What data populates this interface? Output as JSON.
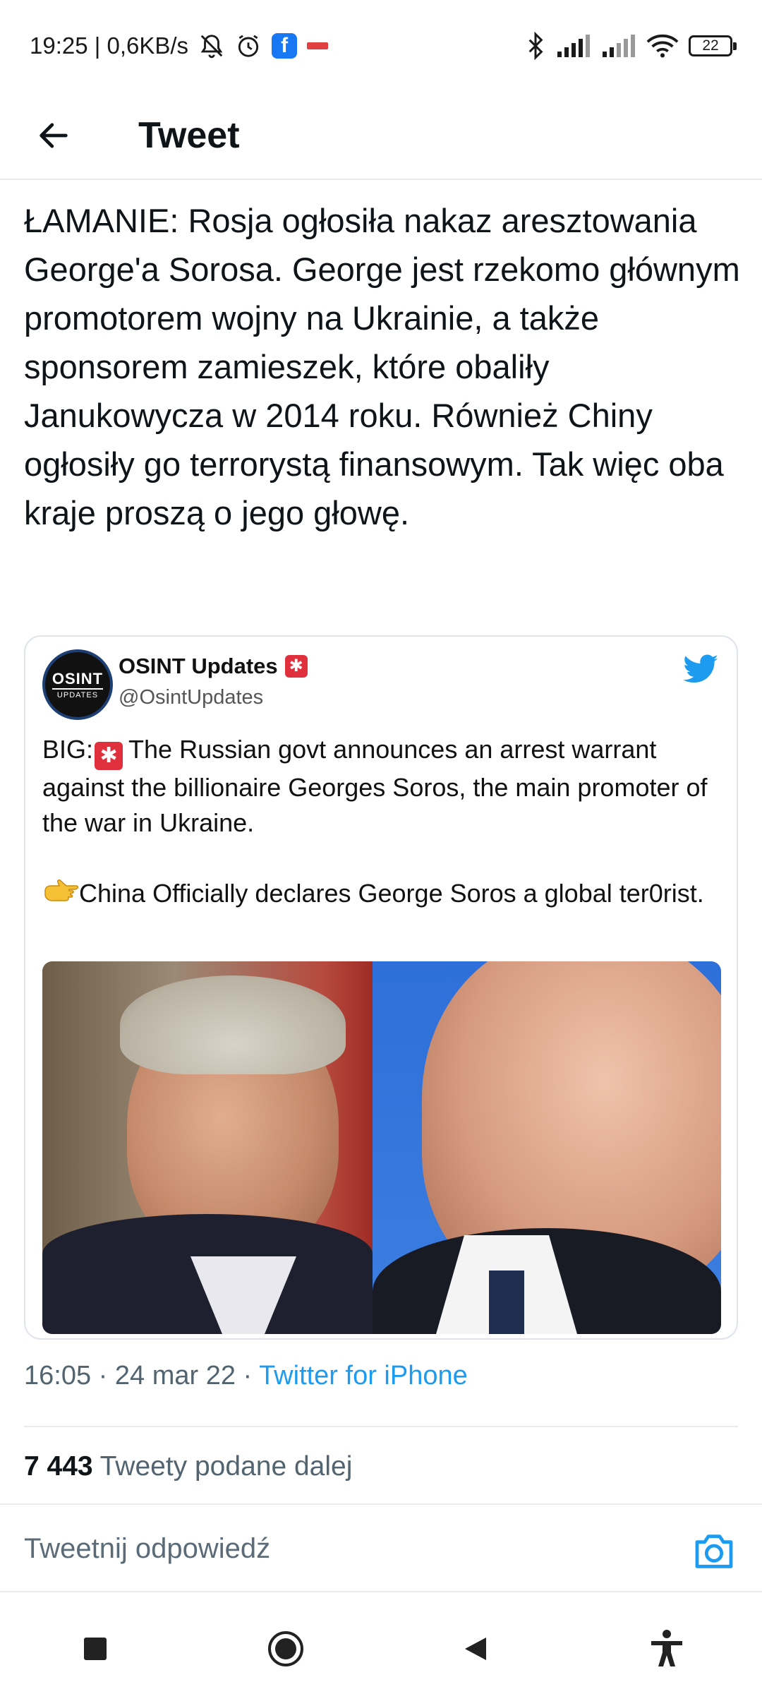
{
  "status_bar": {
    "time_speed": "19:25 | 0,6KB/s",
    "battery": "22"
  },
  "header": {
    "title": "Tweet"
  },
  "tweet": {
    "text": "ŁAMANIE: Rosja ogłosiła nakaz aresztowania George'a Sorosa. George jest rzekomo głównym promotorem wojny na Ukrainie, a także sponsorem zamieszek, które obaliły Janukowycza w 2014 roku. Również Chiny ogłosiły go terrorystą finansowym. Tak więc oba kraje proszą o jego głowę.",
    "time": "16:05",
    "date": "24 mar 22",
    "source": "Twitter for iPhone",
    "retweet_count": "7 443",
    "retweet_label": "Tweety podane dalej"
  },
  "quoted_tweet": {
    "avatar_line1": "OSINT",
    "avatar_line2": "UPDATES",
    "author_name": "OSINT Updates",
    "author_handle": "@OsintUpdates",
    "text_line1_prefix": "BIG:",
    "text_line1_rest": "The Russian govt announces an arrest warrant against the billionaire Georges Soros, the main promoter of the war in Ukraine.",
    "text_line2": "China Officially declares George Soros a global ter0rist."
  },
  "reply": {
    "placeholder": "Tweetnij odpowiedź"
  },
  "colors": {
    "accent": "#1d9bf0",
    "secondary_text": "#536471"
  }
}
